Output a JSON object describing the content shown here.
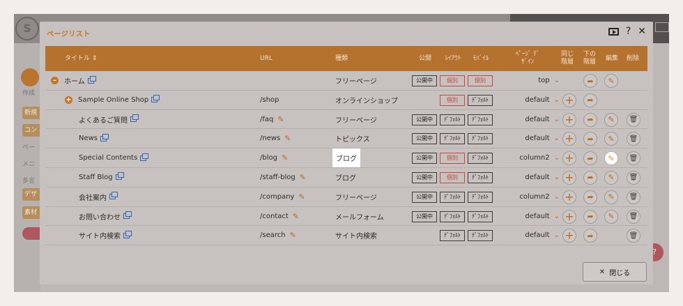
{
  "background": {
    "logo_text": "S",
    "sidebar": {
      "create_label": "作成",
      "items": [
        "新規",
        "コン",
        "ペー",
        "メニ",
        "多言",
        "デザ",
        "素材"
      ]
    }
  },
  "modal": {
    "title": "ページリスト",
    "tools": {
      "help": "?",
      "close": "✕"
    },
    "columns": {
      "title": "タイトル ⇕",
      "url": "URL",
      "type": "種類",
      "public": "公開",
      "layout": "ﾚｲｱｳﾄ",
      "mobile": "ﾓﾊﾞｲﾙ",
      "design": "ﾍﾟｰｼﾞ ﾃﾞｻﾞｲﾝ",
      "same_level": "同じ 階層",
      "lower_level": "下の 階層",
      "edit": "編集",
      "delete": "削除"
    },
    "rows": [
      {
        "title": "ホーム",
        "url": "",
        "type": "フリーページ",
        "public": "公開中",
        "layout": "個別",
        "mobile": "個別",
        "design": "top"
      },
      {
        "title": "Sample Online Shop",
        "url": "/shop",
        "type": "オンラインショップ",
        "public": "",
        "layout": "個別",
        "mobile": "ﾃﾞﾌｫﾙﾄ",
        "design": "default"
      },
      {
        "title": "よくあるご質問",
        "url": "/faq",
        "type": "フリーページ",
        "public": "公開中",
        "layout": "ﾃﾞﾌｫﾙﾄ",
        "mobile": "ﾃﾞﾌｫﾙﾄ",
        "design": "default"
      },
      {
        "title": "News",
        "url": "/news",
        "type": "トピックス",
        "public": "公開中",
        "layout": "ﾃﾞﾌｫﾙﾄ",
        "mobile": "ﾃﾞﾌｫﾙﾄ",
        "design": "default"
      },
      {
        "title": "Special Contents",
        "url": "/blog",
        "type": "ブログ",
        "public": "公開中",
        "layout": "個別",
        "mobile": "ﾃﾞﾌｫﾙﾄ",
        "design": "column2"
      },
      {
        "title": "Staff Blog",
        "url": "/staff-blog",
        "type": "ブログ",
        "public": "公開中",
        "layout": "個別",
        "mobile": "ﾃﾞﾌｫﾙﾄ",
        "design": "default"
      },
      {
        "title": "会社案内",
        "url": "/company",
        "type": "フリーページ",
        "public": "公開中",
        "layout": "ﾃﾞﾌｫﾙﾄ",
        "mobile": "ﾃﾞﾌｫﾙﾄ",
        "design": "column2"
      },
      {
        "title": "お問い合わせ",
        "url": "/contact",
        "type": "メールフォーム",
        "public": "公開中",
        "layout": "ﾃﾞﾌｫﾙﾄ",
        "mobile": "ﾃﾞﾌｫﾙﾄ",
        "design": "default"
      },
      {
        "title": "サイト内検索",
        "url": "/search",
        "type": "サイト内検索",
        "public": "",
        "layout": "ﾃﾞﾌｫﾙﾄ",
        "mobile": "ﾃﾞﾌｫﾙﾄ",
        "design": "default"
      }
    ],
    "close_button": "閉じる"
  },
  "colors": {
    "accent": "#b5722f",
    "title_orange": "#c8731f",
    "red_tag": "#c0483f"
  }
}
